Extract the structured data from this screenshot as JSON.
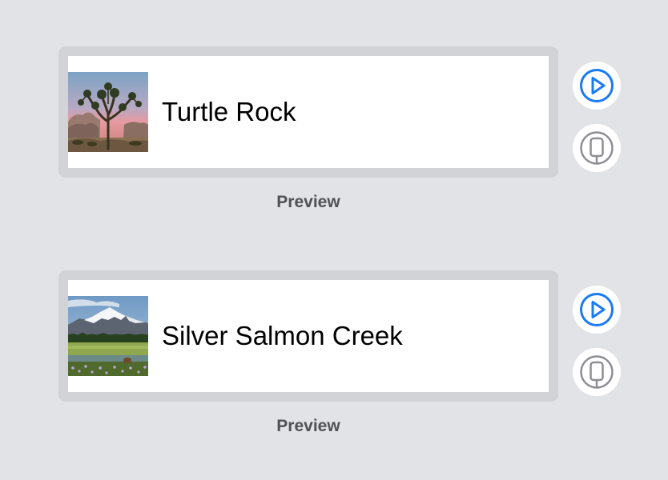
{
  "previews": [
    {
      "landmark_name": "Turtle Rock",
      "thumbnail_icon": "joshua-tree-landscape-image",
      "caption": "Preview",
      "live_icon": "play-circle-icon",
      "device_icon": "device-icon"
    },
    {
      "landmark_name": "Silver Salmon Creek",
      "thumbnail_icon": "mountain-meadow-landscape-image",
      "caption": "Preview",
      "live_icon": "play-circle-icon",
      "device_icon": "device-icon"
    }
  ],
  "colors": {
    "background": "#e2e3e7",
    "frame": "#d2d3d6",
    "accent": "#1a7cf2",
    "icon_gray": "#8e8e93",
    "caption": "#505155"
  }
}
